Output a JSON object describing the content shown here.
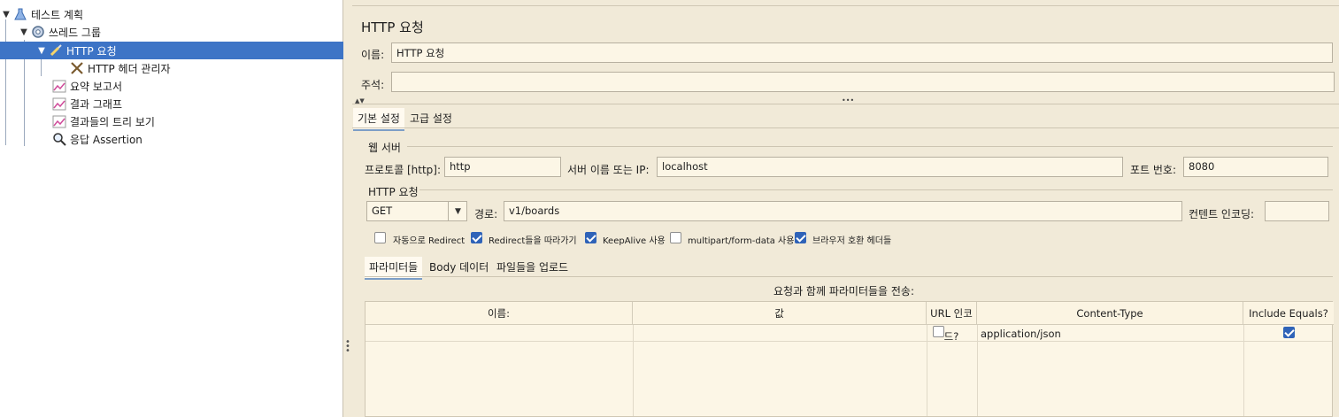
{
  "tree": {
    "items": [
      {
        "label": "테스트 계획",
        "icon": "flask-icon"
      },
      {
        "label": "쓰레드 그룹",
        "icon": "gear-icon"
      },
      {
        "label": "HTTP 요청",
        "icon": "pipette-icon"
      },
      {
        "label": "HTTP 헤더 관리자",
        "icon": "tools-icon"
      },
      {
        "label": "요약 보고서",
        "icon": "chart-icon"
      },
      {
        "label": "결과 그래프",
        "icon": "chart-icon"
      },
      {
        "label": "결과들의 트리 보기",
        "icon": "chart-icon"
      },
      {
        "label": "응답 Assertion",
        "icon": "magnifier-icon"
      }
    ],
    "selected_color": "#3d74c6"
  },
  "panel": {
    "title": "HTTP 요청",
    "name_label": "이름:",
    "name_value": "HTTP 요청",
    "comment_label": "주석:",
    "comment_value": "",
    "collapse_arrows": "▲▼",
    "drag_dots": "•••",
    "tabs": [
      "기본 설정",
      "고급 설정"
    ],
    "web_server": {
      "section_label": "웹 서버",
      "protocol_label": "프로토콜 [http]:",
      "protocol_value": "http",
      "server_label": "서버 이름 또는 IP:",
      "server_value": "localhost",
      "port_label": "포트 번호:",
      "port_value": "8080"
    },
    "http_request": {
      "section_label": "HTTP 요청",
      "method_value": "GET",
      "path_label": "경로:",
      "path_value": "v1/boards",
      "encoding_label": "컨텐트 인코딩:",
      "encoding_value": ""
    },
    "options": [
      {
        "label": "자동으로 Redirect",
        "checked": false
      },
      {
        "label": "Redirect들을 따라가기",
        "checked": true
      },
      {
        "label": "KeepAlive 사용",
        "checked": true
      },
      {
        "label": "multipart/form-data 사용",
        "checked": false
      },
      {
        "label": "브라우저 호환 헤더들",
        "checked": true
      }
    ],
    "sub_tabs": [
      "파라미터들",
      "Body 데이터",
      "파일들을 업로드"
    ],
    "params_caption": "요청과 함께 파라미터들을 전송:",
    "table": {
      "headers": [
        "이름:",
        "값",
        "URL 인코드?",
        "Content-Type",
        "Include Equals?"
      ],
      "rows": [
        {
          "name": "",
          "value": "",
          "url_encode": false,
          "content_type": "application/json",
          "include_equals": true
        }
      ]
    }
  }
}
